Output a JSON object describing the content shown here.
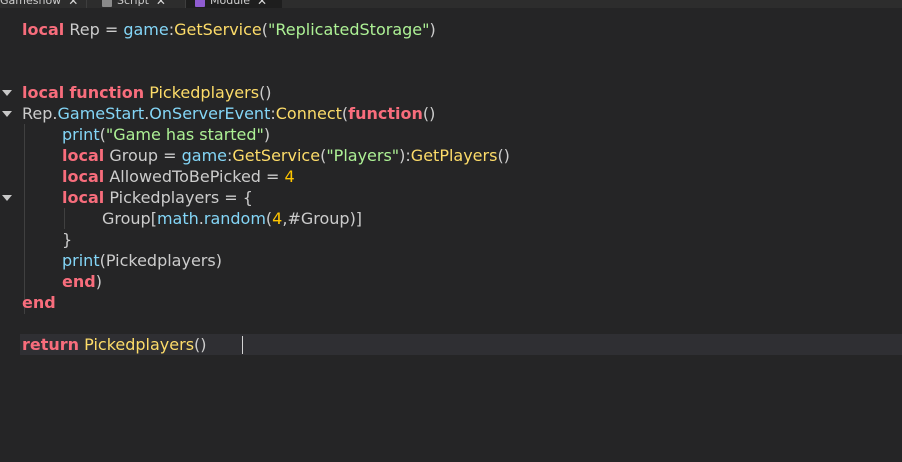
{
  "tabs": [
    {
      "label": "Gameshow",
      "close": "✕",
      "active": false
    },
    {
      "label": "Script",
      "close": "✕",
      "active": false
    },
    {
      "label": "Module",
      "close": "✕",
      "active": true
    }
  ],
  "colors": {
    "keyword": "#f86d7c",
    "string": "#adf195",
    "number": "#ffc600",
    "function_name": "#fddc69",
    "builtin": "#84d6f7",
    "text": "#cccccc",
    "background": "#252526"
  },
  "code": {
    "lines": [
      {
        "tokens": [
          {
            "t": "local",
            "k": "kw"
          },
          {
            "t": " Rep = ",
            "k": "txt"
          },
          {
            "t": "game",
            "k": "blt"
          },
          {
            "t": ":",
            "k": "txt"
          },
          {
            "t": "GetService",
            "k": "meth"
          },
          {
            "t": "(",
            "k": "txt"
          },
          {
            "t": "\"ReplicatedStorage\"",
            "k": "str"
          },
          {
            "t": ")",
            "k": "txt"
          }
        ]
      },
      {
        "tokens": []
      },
      {
        "tokens": []
      },
      {
        "fold": true,
        "tokens": [
          {
            "t": "local",
            "k": "kw"
          },
          {
            "t": " ",
            "k": "txt"
          },
          {
            "t": "function",
            "k": "kw"
          },
          {
            "t": " ",
            "k": "txt"
          },
          {
            "t": "Pickedplayers",
            "k": "fn"
          },
          {
            "t": "()",
            "k": "txt"
          }
        ]
      },
      {
        "fold": true,
        "tokens": [
          {
            "t": "Rep.",
            "k": "txt"
          },
          {
            "t": "GameStart",
            "k": "blt"
          },
          {
            "t": ".",
            "k": "txt"
          },
          {
            "t": "OnServerEvent",
            "k": "blt"
          },
          {
            "t": ":",
            "k": "txt"
          },
          {
            "t": "Connect",
            "k": "meth"
          },
          {
            "t": "(",
            "k": "txt"
          },
          {
            "t": "function",
            "k": "kw"
          },
          {
            "t": "()",
            "k": "txt"
          }
        ]
      },
      {
        "indent": 1,
        "tokens": [
          {
            "t": "print",
            "k": "blt"
          },
          {
            "t": "(",
            "k": "txt"
          },
          {
            "t": "\"Game has started\"",
            "k": "str"
          },
          {
            "t": ")",
            "k": "txt"
          }
        ]
      },
      {
        "indent": 1,
        "tokens": [
          {
            "t": "local",
            "k": "kw"
          },
          {
            "t": " Group = ",
            "k": "txt"
          },
          {
            "t": "game",
            "k": "blt"
          },
          {
            "t": ":",
            "k": "txt"
          },
          {
            "t": "GetService",
            "k": "meth"
          },
          {
            "t": "(",
            "k": "txt"
          },
          {
            "t": "\"Players\"",
            "k": "str"
          },
          {
            "t": "):",
            "k": "txt"
          },
          {
            "t": "GetPlayers",
            "k": "meth"
          },
          {
            "t": "()",
            "k": "txt"
          }
        ]
      },
      {
        "indent": 1,
        "tokens": [
          {
            "t": "local",
            "k": "kw"
          },
          {
            "t": " AllowedToBePicked = ",
            "k": "txt"
          },
          {
            "t": "4",
            "k": "num"
          }
        ]
      },
      {
        "indent": 1,
        "fold": true,
        "tokens": [
          {
            "t": "local",
            "k": "kw"
          },
          {
            "t": " Pickedplayers = {",
            "k": "txt"
          }
        ]
      },
      {
        "indent": 2,
        "tokens": [
          {
            "t": "Group[",
            "k": "txt"
          },
          {
            "t": "math",
            "k": "blt"
          },
          {
            "t": ".",
            "k": "txt"
          },
          {
            "t": "random",
            "k": "blt"
          },
          {
            "t": "(",
            "k": "txt"
          },
          {
            "t": "4",
            "k": "num"
          },
          {
            "t": ",#Group)]",
            "k": "txt"
          }
        ]
      },
      {
        "indent": 1,
        "tokens": [
          {
            "t": "}",
            "k": "txt"
          }
        ]
      },
      {
        "indent": 1,
        "tokens": [
          {
            "t": "print",
            "k": "blt"
          },
          {
            "t": "(Pickedplayers)",
            "k": "txt"
          }
        ]
      },
      {
        "indent": 1,
        "tokens": [
          {
            "t": "end",
            "k": "kw"
          },
          {
            "t": ")",
            "k": "txt"
          }
        ]
      },
      {
        "tokens": [
          {
            "t": "end",
            "k": "kw"
          }
        ]
      },
      {
        "tokens": []
      },
      {
        "current": true,
        "tokens": [
          {
            "t": "return",
            "k": "kw"
          },
          {
            "t": " ",
            "k": "txt"
          },
          {
            "t": "Pickedplayers",
            "k": "fn"
          },
          {
            "t": "()",
            "k": "txt"
          }
        ]
      }
    ]
  }
}
